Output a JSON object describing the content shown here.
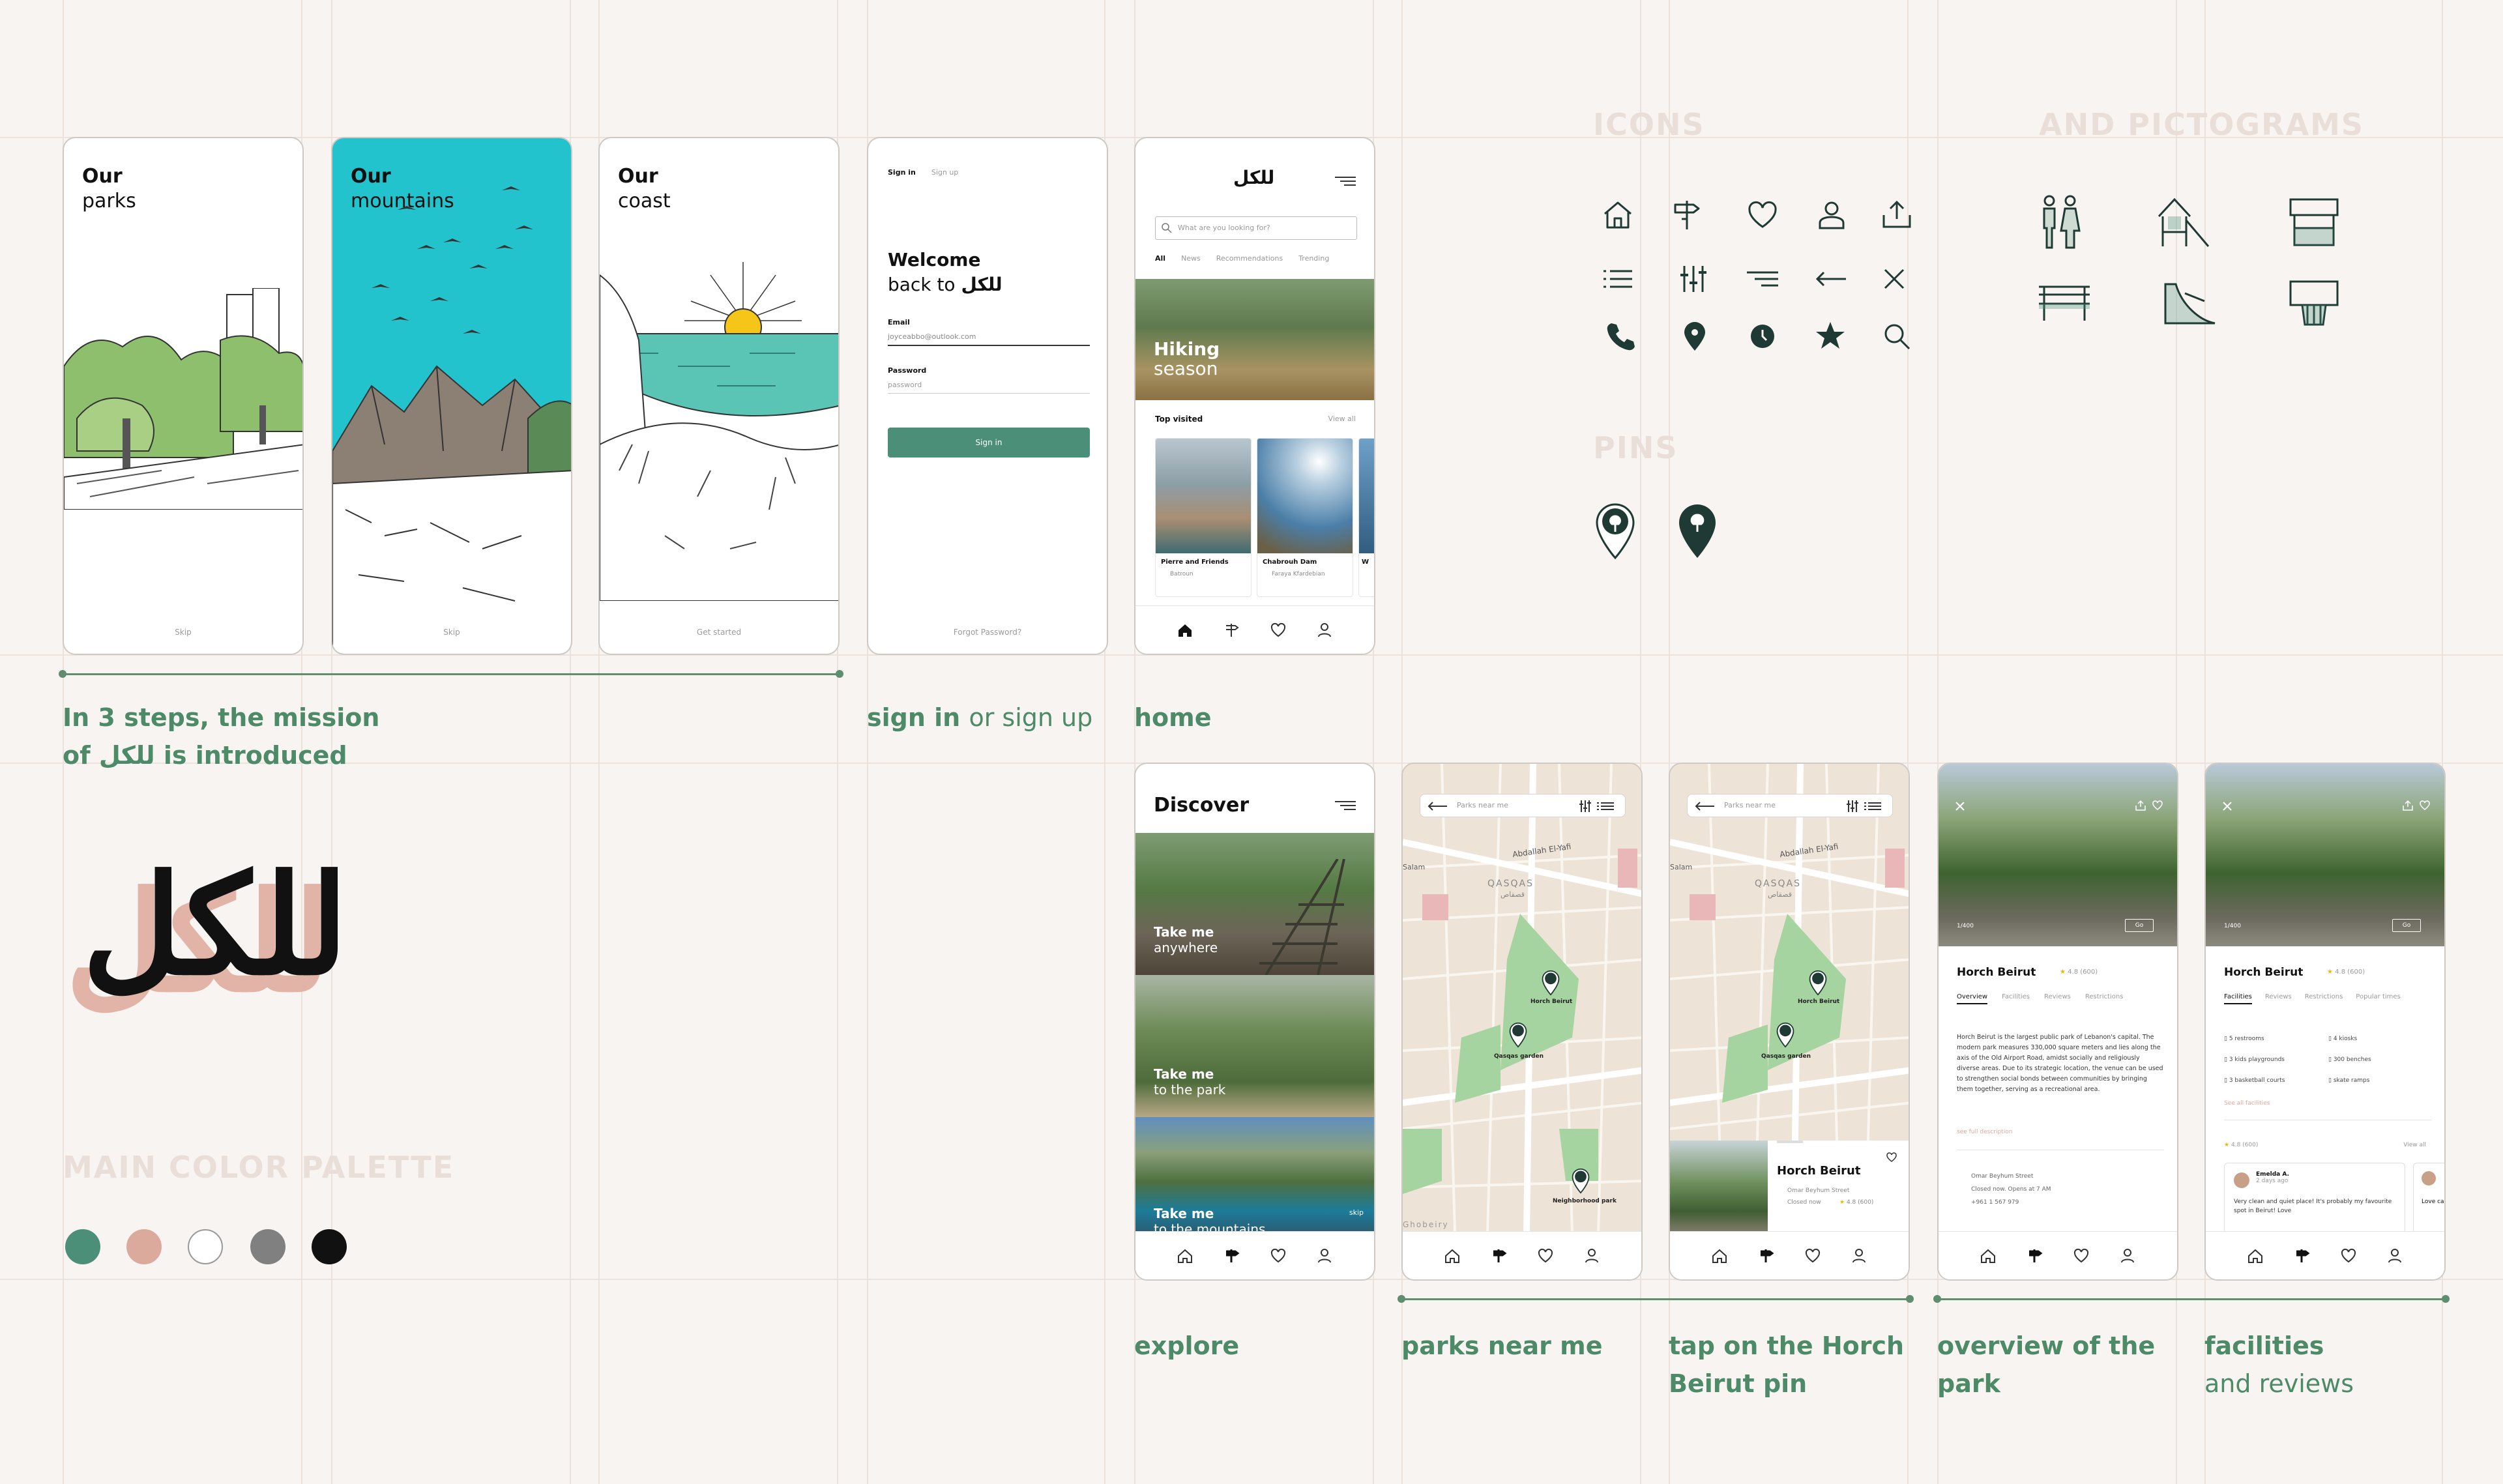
{
  "onboarding": [
    {
      "line1": "Our",
      "line2": "parks",
      "footer": "Skip"
    },
    {
      "line1": "Our",
      "line2": "mountains",
      "footer": "Skip"
    },
    {
      "line1": "Our",
      "line2": "coast",
      "footer": "Get started"
    }
  ],
  "signin": {
    "tab_signin": "Sign in",
    "tab_signup": "Sign up",
    "welcome": "Welcome",
    "back_to": "back to",
    "brand": "للكل",
    "email_label": "Email",
    "email_value": "joyceabbo@outlook.com",
    "password_label": "Password",
    "password_value": "password",
    "button": "Sign in",
    "forgot": "Forgot Password?"
  },
  "home": {
    "logo": "للكل",
    "search_placeholder": "What are you looking for?",
    "tabs": [
      "All",
      "News",
      "Recommendations",
      "Trending"
    ],
    "hero_l1": "Hiking",
    "hero_l2": "season",
    "top_visited": "Top visited",
    "view_all": "View all",
    "cards": [
      {
        "title": "Pierre and Friends",
        "loc": "Batroun"
      },
      {
        "title": "Chabrouh Dam",
        "loc": "Faraya Kfardebian"
      },
      {
        "title": "W",
        "loc": ""
      }
    ]
  },
  "captions": {
    "steps_a": "In 3 steps, the mission",
    "steps_b_pre": "of",
    "steps_b_brand": "للكل",
    "steps_b_post": "is introduced",
    "signin_b": "sign in",
    "signin_t": "or sign up",
    "home": "home",
    "explore": "explore",
    "parks": "parks near me",
    "tap_a": "tap on the Horch",
    "tap_b": "Beirut pin",
    "overview_a": "overview of the",
    "overview_b": "park",
    "facilities_a": "facilities",
    "facilities_b": "and reviews"
  },
  "brand_logo": "للكل",
  "palette": {
    "title": "MAIN COLOR PALETTE",
    "colors": [
      "#4c8f79",
      "#dcaa9c",
      "#ffffff",
      "#808080",
      "#111111"
    ]
  },
  "icons_section": {
    "title_left": "ICONS",
    "title_right": "AND PICTOGRAMS",
    "pins_title": "PINS",
    "icon_names": [
      "home-icon",
      "signpost-icon",
      "heart-icon",
      "user-icon",
      "share-icon",
      "list-icon",
      "sliders-icon",
      "menu-icon",
      "arrow-left-icon",
      "close-icon",
      "phone-icon",
      "location-icon",
      "clock-icon",
      "star-icon",
      "search-icon"
    ],
    "pictograms": [
      "restroom-pictogram",
      "playground-pictogram",
      "kiosk-pictogram",
      "bench-pictogram",
      "skate-ramp-pictogram",
      "basketball-pictogram"
    ]
  },
  "explore": {
    "title": "Discover",
    "items": [
      {
        "l1": "Take me",
        "l2": "anywhere"
      },
      {
        "l1": "Take me",
        "l2": "to the park"
      },
      {
        "l1": "Take me",
        "l2": "to the mountains"
      }
    ],
    "skip": "skip"
  },
  "map": {
    "search_placeholder": "Parks near me",
    "labels": [
      "Salam",
      "Abdallah El-Yafi",
      "QASQAS",
      "قصقاص",
      "Horch Beirut",
      "Qasqas garden",
      "Neighborhood park",
      "Ghobeiry"
    ]
  },
  "pin_card": {
    "title": "Horch Beirut",
    "address": "Omar Beyhum Street",
    "status": "Closed now",
    "rating": "4.8",
    "count": "(600)"
  },
  "overview": {
    "photo_count": "1/400",
    "go": "Go",
    "title": "Horch Beirut",
    "rating": "4.8",
    "count": "(600)",
    "tabs": [
      "Overview",
      "Facilities",
      "Reviews",
      "Restrictions"
    ],
    "description": "Horch Beirut is the largest public park of Lebanon's capital. The modern park measures 330,000 square meters and lies along the axis of the Old Airport Road, amidst socially and religiously diverse areas. Due to its strategic location, the venue can be used to strengthen social bonds between communities by bringing them together, serving as a recreational area.",
    "see_full": "see full description",
    "address": "Omar Beyhum Street",
    "hours": "Closed now. Opens at 7 AM",
    "phone": "+961 1 567 979"
  },
  "facilities": {
    "tabs": [
      "Facilities",
      "Reviews",
      "Restrictions",
      "Popular times"
    ],
    "items": [
      "5 restrooms",
      "4 kiosks",
      "3 kids playgrounds",
      "300 benches",
      "3 basketball courts",
      "skate ramps"
    ],
    "see_all": "See all facilities",
    "rating": "4.8",
    "count": "(600)",
    "view_all": "View all",
    "reviewer": "Emelda A.",
    "review_time": "2 days ago",
    "review": "Very clean and quiet place! It's probably my favourite spot in Beirut! Love",
    "review2": "Love calm"
  }
}
